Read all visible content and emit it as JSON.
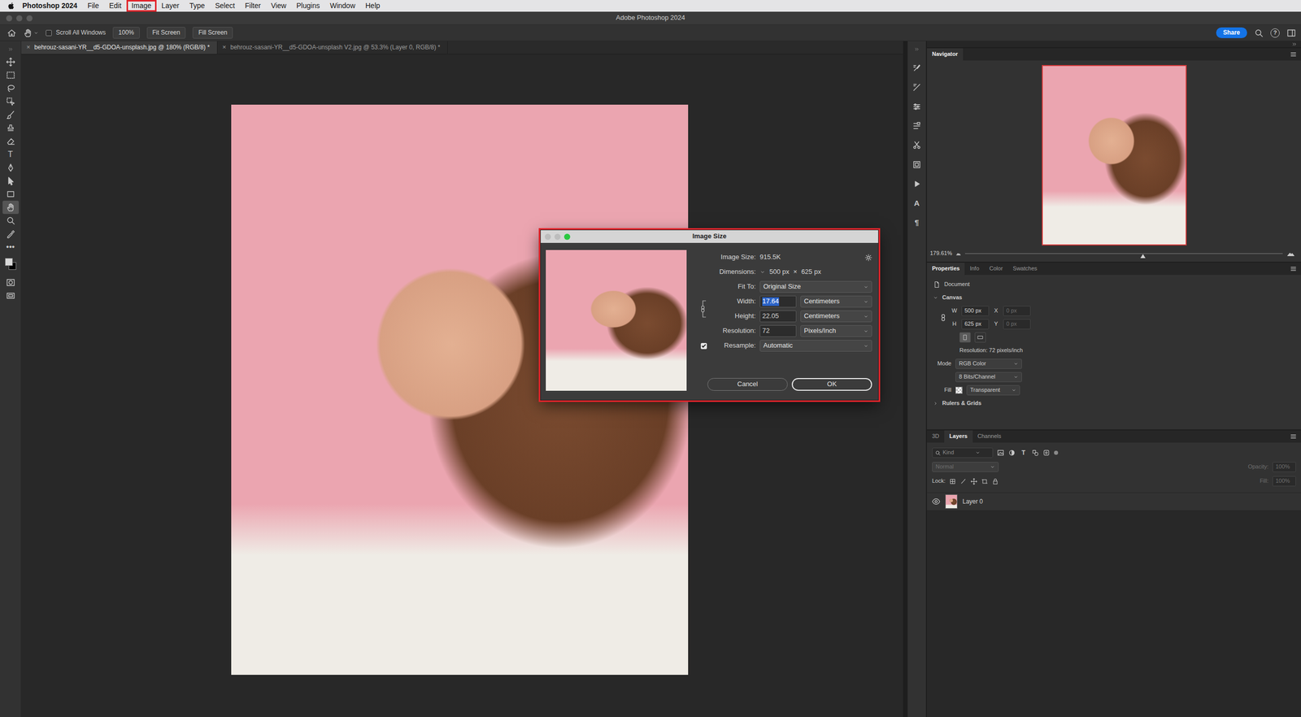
{
  "menubar": {
    "app": "Photoshop 2024",
    "items": [
      {
        "label": "File",
        "selected": false
      },
      {
        "label": "Edit",
        "selected": false
      },
      {
        "label": "Image",
        "selected": true
      },
      {
        "label": "Layer",
        "selected": false
      },
      {
        "label": "Type",
        "selected": false
      },
      {
        "label": "Select",
        "selected": false
      },
      {
        "label": "Filter",
        "selected": false
      },
      {
        "label": "View",
        "selected": false
      },
      {
        "label": "Plugins",
        "selected": false
      },
      {
        "label": "Window",
        "selected": false
      },
      {
        "label": "Help",
        "selected": false
      }
    ]
  },
  "window": {
    "title": "Adobe Photoshop 2024"
  },
  "options_bar": {
    "scroll_all_windows": {
      "label": "Scroll All Windows",
      "checked": false
    },
    "buttons": [
      "100%",
      "Fit Screen",
      "Fill Screen"
    ],
    "share": "Share",
    "help": "?"
  },
  "tools": [
    {
      "kind": "icon",
      "selected": false
    },
    {
      "kind": "icon",
      "selected": false
    },
    {
      "kind": "icon",
      "selected": false
    },
    {
      "kind": "icon",
      "selected": false
    },
    {
      "kind": "icon",
      "selected": false
    },
    {
      "kind": "icon",
      "selected": false
    },
    {
      "kind": "icon",
      "selected": false
    },
    {
      "kind": "glyph",
      "glyph": "T",
      "selected": false
    },
    {
      "kind": "icon",
      "selected": false
    },
    {
      "kind": "icon",
      "selected": false
    },
    {
      "kind": "icon",
      "selected": false
    },
    {
      "kind": "icon",
      "selected": true
    },
    {
      "kind": "icon",
      "selected": false
    },
    {
      "kind": "icon",
      "selected": false
    },
    {
      "kind": "glyph",
      "glyph": "•••",
      "selected": false
    },
    {
      "kind": "icon",
      "selected": false
    },
    {
      "kind": "icon",
      "selected": false
    }
  ],
  "document_tabs": [
    {
      "label": "behrouz-sasani-YR__d5-GDOA-unsplash.jpg @ 180% (RGB/8) *",
      "close": "×",
      "selected": true
    },
    {
      "label": "behrouz-sasani-YR__d5-GDOA-unsplash V2.jpg @ 53.3% (Layer 0, RGB/8) *",
      "close": "×",
      "selected": false
    }
  ],
  "image_size_dialog": {
    "title": "Image Size",
    "highlighted": true,
    "image_size": {
      "label": "Image Size:",
      "value": "915.5K"
    },
    "dimensions": {
      "label": "Dimensions:",
      "width": "500 px",
      "separator": "×",
      "height": "625 px"
    },
    "fit_to": {
      "label": "Fit To:",
      "value": "Original Size"
    },
    "width": {
      "label": "Width:",
      "value": "17.64",
      "unit": "Centimeters",
      "selected": true
    },
    "height": {
      "label": "Height:",
      "value": "22.05",
      "unit": "Centimeters"
    },
    "resolution": {
      "label": "Resolution:",
      "value": "72",
      "unit": "Pixels/Inch"
    },
    "resample": {
      "label": "Resample:",
      "value": "Automatic",
      "checked": true
    },
    "constrain_proportions": true,
    "buttons": [
      {
        "label": "Cancel",
        "default": false
      },
      {
        "label": "OK",
        "default": true
      }
    ]
  },
  "panel_strip": [
    {
      "kind": "icon"
    },
    {
      "kind": "icon"
    },
    {
      "kind": "icon"
    },
    {
      "kind": "icon"
    },
    {
      "kind": "icon"
    },
    {
      "kind": "icon"
    },
    {
      "kind": "icon"
    },
    {
      "kind": "glyph",
      "glyph": "A"
    },
    {
      "kind": "glyph",
      "glyph": "¶"
    }
  ],
  "navigator": {
    "title": "Navigator",
    "zoom": "179.61%",
    "level": 0.56
  },
  "properties": {
    "tabs": [
      {
        "label": "Properties",
        "selected": true
      },
      {
        "label": "Info",
        "selected": false
      },
      {
        "label": "Color",
        "selected": false
      },
      {
        "label": "Swatches",
        "selected": false
      }
    ],
    "document": "Document",
    "canvas": {
      "title": "Canvas",
      "expanded": true
    },
    "w": {
      "label": "W",
      "value": "500 px"
    },
    "x": {
      "label": "X",
      "value": "0 px",
      "disabled": true
    },
    "h": {
      "label": "H",
      "value": "625 px"
    },
    "y": {
      "label": "Y",
      "value": "0 px",
      "disabled": true
    },
    "orientation": [
      {
        "selected": true
      },
      {
        "selected": false
      }
    ],
    "resolution": "Resolution: 72 pixels/inch",
    "mode": {
      "label": "Mode",
      "value": "RGB Color"
    },
    "bits": "8 Bits/Channel",
    "fill": {
      "label": "Fill",
      "value": "Transparent"
    },
    "next_section": "Rulers & Grids"
  },
  "layers": {
    "tabs": [
      {
        "label": "3D",
        "selected": false
      },
      {
        "label": "Layers",
        "selected": true
      },
      {
        "label": "Channels",
        "selected": false
      }
    ],
    "filter": {
      "placeholder": "Kind"
    },
    "filter_icons": [
      {
        "kind": "icon"
      },
      {
        "kind": "icon"
      },
      {
        "kind": "glyph",
        "glyph": "T"
      },
      {
        "kind": "icon"
      },
      {
        "kind": "icon"
      }
    ],
    "blend_mode": {
      "value": "Normal",
      "disabled": true
    },
    "opacity": {
      "label": "Opacity:",
      "value": "100%",
      "disabled": true
    },
    "lock": {
      "label": "Lock:"
    },
    "fill": {
      "label": "Fill:",
      "value": "100%",
      "disabled": true
    },
    "items": [
      {
        "name": "Layer 0",
        "visible": true,
        "selected": false
      }
    ]
  }
}
